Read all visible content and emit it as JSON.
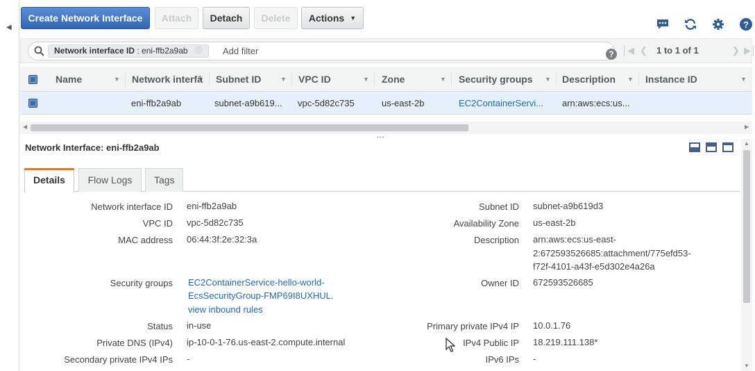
{
  "toolbar": {
    "create_label": "Create Network Interface",
    "attach_label": "Attach",
    "detach_label": "Detach",
    "delete_label": "Delete",
    "actions_label": "Actions",
    "icons": [
      "chat-icon",
      "refresh-icon",
      "gear-icon",
      "help-icon"
    ]
  },
  "filter": {
    "chip_key": "Network interface ID",
    "chip_value": ": eni-ffb2a9ab",
    "placeholder": "Add filter"
  },
  "pager": {
    "text": "1 to 1 of 1"
  },
  "table": {
    "headers": [
      "Name",
      "Network interfā",
      "Subnet ID",
      "VPC ID",
      "Zone",
      "Security groups",
      "Description",
      "Instance ID"
    ],
    "rows": [
      {
        "name": "",
        "network_interface": "eni-ffb2a9ab",
        "subnet_id": "subnet-a9b619...",
        "vpc_id": "vpc-5d82c735",
        "zone": "us-east-2b",
        "security_groups": "EC2ContainerServi...",
        "description": "arn:aws:ecs:us...",
        "instance_id": ""
      }
    ]
  },
  "detail": {
    "title": "Network Interface: eni-ffb2a9ab",
    "tabs": [
      "Details",
      "Flow Logs",
      "Tags"
    ],
    "active_tab": "Details",
    "left": {
      "network_interface_id": {
        "label": "Network interface ID",
        "value": "eni-ffb2a9ab"
      },
      "vpc_id": {
        "label": "VPC ID",
        "value": "vpc-5d82c735"
      },
      "mac_address": {
        "label": "MAC address",
        "value": "06:44:3f:2e:32:3a"
      },
      "security_groups": {
        "label": "Security groups",
        "value_line1": "EC2ContainerService-hello-world-",
        "value_line2": "EcsSecurityGroup-FMP69I8UXHUL",
        "value_line2_suffix": ".",
        "link": "view inbound rules"
      },
      "status": {
        "label": "Status",
        "value": "in-use"
      },
      "private_dns": {
        "label": "Private DNS (IPv4)",
        "value": "ip-10-0-1-76.us-east-2.compute.internal"
      },
      "secondary_ips": {
        "label": "Secondary private IPv4 IPs",
        "value": "-"
      }
    },
    "right": {
      "subnet_id": {
        "label": "Subnet ID",
        "value": "subnet-a9b619d3"
      },
      "availability_zone": {
        "label": "Availability Zone",
        "value": "us-east-2b"
      },
      "description": {
        "label": "Description",
        "line1": "arn:aws:ecs:us-east-",
        "line2": "2:672593526685:attachment/775efd53-",
        "line3": "f72f-4101-a43f-e5d302e4a26a"
      },
      "owner_id": {
        "label": "Owner ID",
        "value": "672593526685"
      },
      "primary_private_ip": {
        "label": "Primary private IPv4 IP",
        "value": "10.0.1.76"
      },
      "ipv4_public_ip": {
        "label": "IPv4 Public IP",
        "value": "18.219.111.138*"
      },
      "ipv6_ips": {
        "label": "IPv6 IPs",
        "value": "-"
      }
    }
  }
}
